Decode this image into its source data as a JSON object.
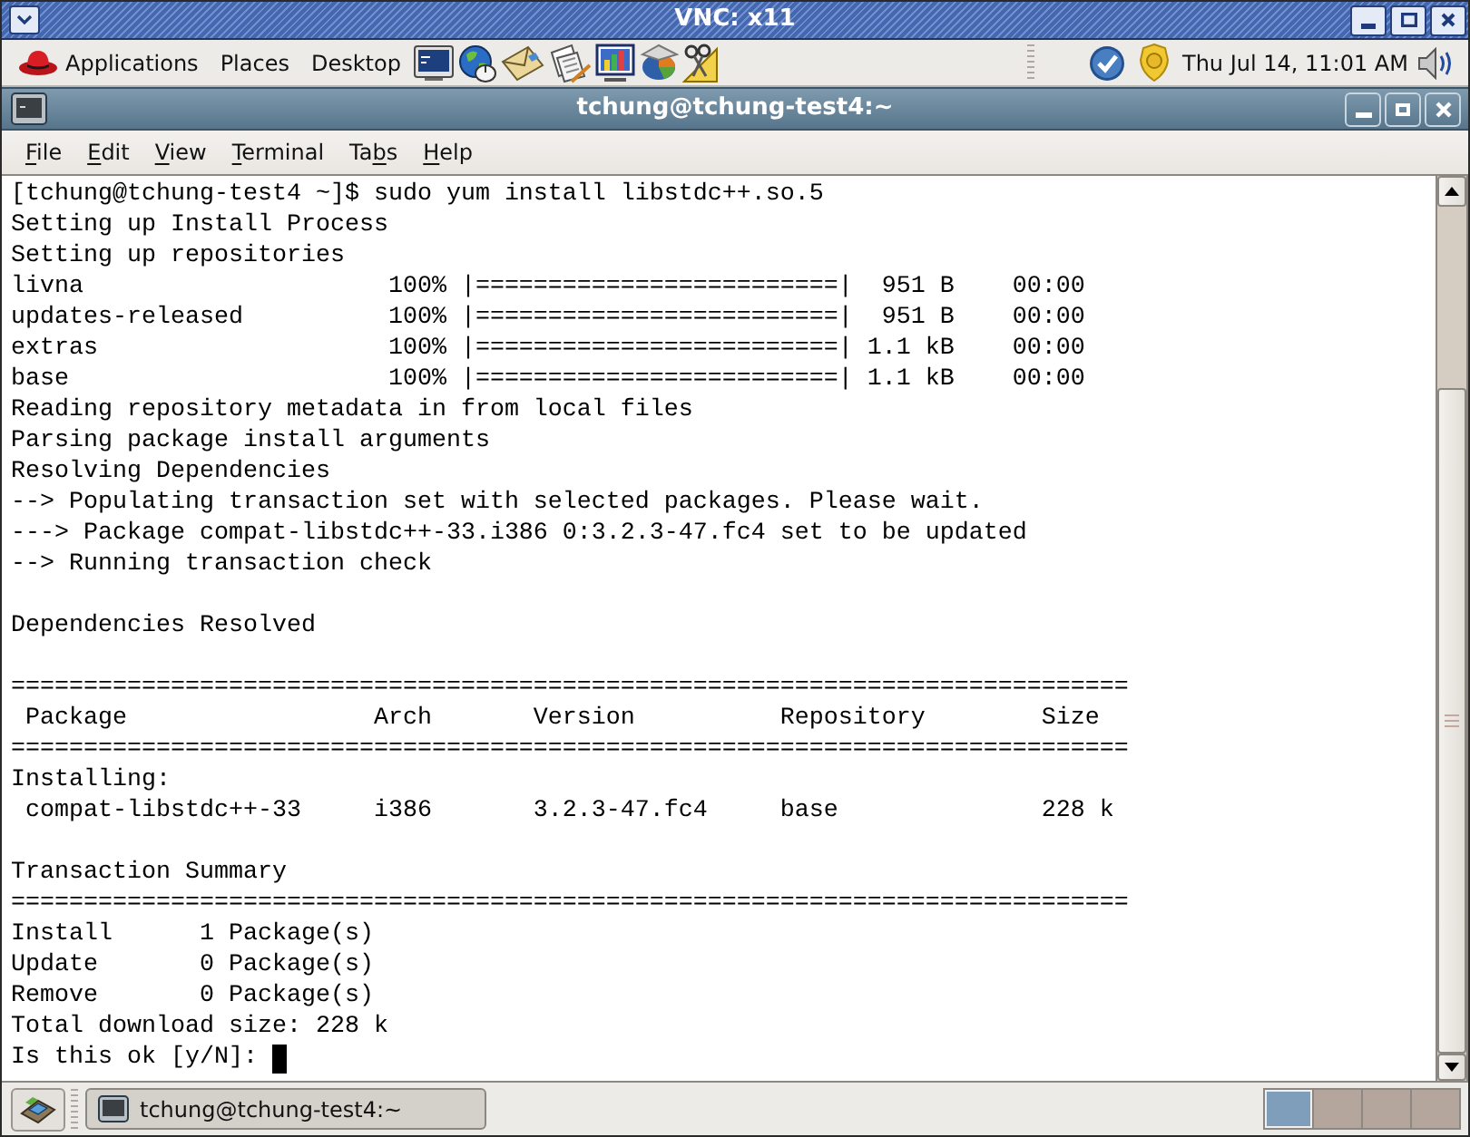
{
  "vnc_window": {
    "title": "VNC: x11"
  },
  "top_panel": {
    "menus": [
      {
        "label": "Applications"
      },
      {
        "label": "Places"
      },
      {
        "label": "Desktop"
      }
    ],
    "clock": "Thu Jul 14, 11:01 AM"
  },
  "terminal_window": {
    "title": "tchung@tchung-test4:~",
    "menu": [
      {
        "mnemonic": "F",
        "after": "ile"
      },
      {
        "mnemonic": "E",
        "after": "dit"
      },
      {
        "mnemonic": "V",
        "after": "iew"
      },
      {
        "mnemonic": "T",
        "after": "erminal"
      },
      {
        "before": "Ta",
        "mnemonic": "b",
        "after": "s"
      },
      {
        "mnemonic": "H",
        "after": "elp"
      }
    ],
    "output_blocks": [
      {
        "lines": [
          "[tchung@tchung-test4 ~]$ sudo yum install libstdc++.so.5",
          "Setting up Install Process",
          "Setting up repositories",
          "livna                     100% |=========================|  951 B    00:00",
          "updates-released          100% |=========================|  951 B    00:00",
          "extras                    100% |=========================| 1.1 kB    00:00",
          "base                      100% |=========================| 1.1 kB    00:00",
          "Reading repository metadata in from local files",
          "Parsing package install arguments",
          "Resolving Dependencies",
          "--> Populating transaction set with selected packages. Please wait.",
          "---> Package compat-libstdc++-33.i386 0:3.2.3-47.fc4 set to be updated",
          "--> Running transaction check"
        ]
      },
      {
        "lines": [
          "Dependencies Resolved"
        ]
      },
      {
        "lines": [
          "=============================================================================",
          " Package                 Arch       Version          Repository        Size",
          "=============================================================================",
          "Installing:",
          " compat-libstdc++-33     i386       3.2.3-47.fc4     base              228 k"
        ]
      },
      {
        "lines": [
          "Transaction Summary",
          "=============================================================================",
          "Install      1 Package(s)",
          "Update       0 Package(s)",
          "Remove       0 Package(s)",
          "Total download size: 228 k"
        ]
      }
    ],
    "prompt": {
      "text": "Is this ok [y/N]:",
      "cursor": true
    }
  },
  "bottom_panel": {
    "tasks": [
      {
        "title": "tchung@tchung-test4:~",
        "selected": true
      }
    ],
    "workspaces": [
      {
        "selected": true
      },
      {
        "selected": false
      },
      {
        "selected": false
      },
      {
        "selected": false
      }
    ]
  }
}
